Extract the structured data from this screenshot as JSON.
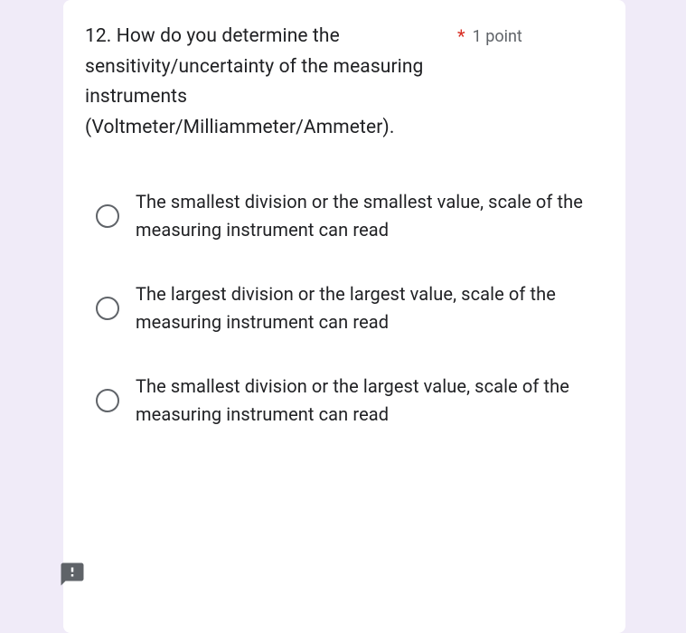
{
  "question": {
    "text": "12. How do you determine the sensitivity/uncertainty of the measuring instruments (Voltmeter/Milliammeter/Ammeter).",
    "required_marker": "*",
    "points": "1 point"
  },
  "options": [
    {
      "label": "The smallest division or the smallest value, scale of the measuring instrument can read"
    },
    {
      "label": "The largest division or the largest value, scale of the measuring instrument can read"
    },
    {
      "label": "The smallest division or the largest value, scale of the measuring instrument can read"
    }
  ],
  "feedback_icon": "feedback-icon"
}
